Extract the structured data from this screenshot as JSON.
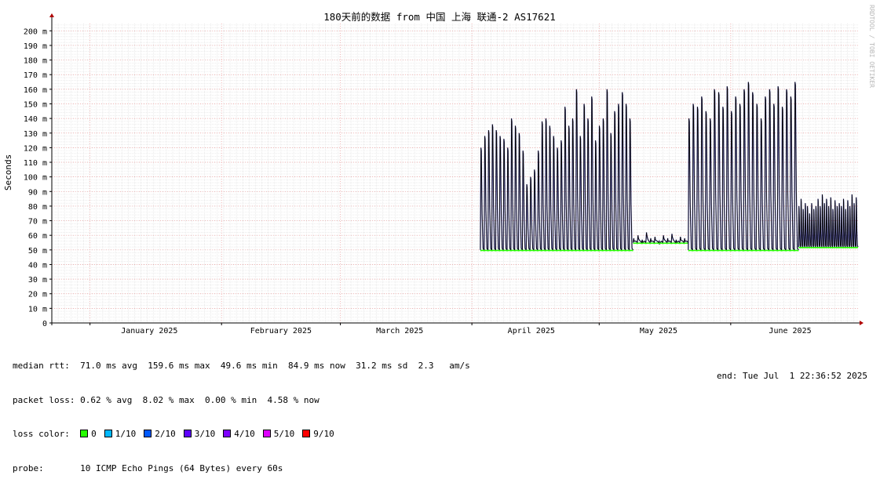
{
  "watermark": "RRDTOOL / TOBI OETIKER",
  "colors": {
    "grid_minor": "#e0e0e0",
    "grid_major": "#f0a0a0",
    "axis": "#000000",
    "arrow": "#b00000",
    "rtt_line": "#000000",
    "rtt_smoke": "#2020d0",
    "loss_0": "#26ff00",
    "loss_1": "#00b8ff",
    "loss_2": "#0059ff",
    "loss_3": "#5e00ff",
    "loss_4": "#7e00ff",
    "loss_5": "#dd00ff",
    "loss_9": "#ff0000"
  },
  "chart_data": {
    "type": "line",
    "title": "180天前的数据 from 中国 上海 联通-2 AS17621",
    "ylabel": "Seconds",
    "ylim": [
      0,
      205
    ],
    "y_tick_labels": [
      "0",
      "10 m",
      "20 m",
      "30 m",
      "40 m",
      "50 m",
      "60 m",
      "70 m",
      "80 m",
      "90 m",
      "100 m",
      "110 m",
      "120 m",
      "130 m",
      "140 m",
      "150 m",
      "160 m",
      "170 m",
      "180 m",
      "190 m",
      "200 m"
    ],
    "x_tick_labels": [
      "January 2025",
      "February 2025",
      "March 2025",
      "April 2025",
      "May 2025",
      "June 2025"
    ],
    "x_range": [
      "2024-12-23",
      "2025-07-01"
    ],
    "x_label_dates": [
      "2025-01-15",
      "2025-02-15",
      "2025-03-15",
      "2025-04-15",
      "2025-05-15",
      "2025-06-15"
    ],
    "x_major_dates": [
      "2025-01-01",
      "2025-02-01",
      "2025-03-01",
      "2025-04-01",
      "2025-05-01",
      "2025-06-01"
    ],
    "grid": true,
    "series": [
      {
        "name": "median rtt",
        "unit": "ms",
        "segments": [
          {
            "start": "2025-04-03",
            "end": "2025-05-09",
            "base": 50,
            "peaks": [
              120,
              128,
              132,
              136,
              132,
              128,
              126,
              120,
              140,
              135,
              130,
              118,
              95,
              100,
              105,
              118,
              138,
              140,
              135,
              128,
              120,
              125,
              148,
              135,
              140,
              160,
              128,
              150,
              140,
              155,
              125,
              135,
              140,
              160,
              130,
              145,
              150,
              158,
              150,
              140
            ]
          },
          {
            "start": "2025-05-09",
            "end": "2025-05-22",
            "base": 55,
            "peaks": [
              58,
              60,
              57,
              62,
              58,
              59,
              56,
              60,
              58,
              61,
              57,
              59,
              58
            ]
          },
          {
            "start": "2025-05-22",
            "end": "2025-06-17",
            "base": 50,
            "peaks": [
              140,
              150,
              148,
              155,
              145,
              140,
              160,
              158,
              148,
              162,
              145,
              155,
              150,
              160,
              165,
              158,
              150,
              140,
              155,
              160,
              150,
              162,
              148,
              160,
              155,
              165
            ]
          },
          {
            "start": "2025-06-17",
            "end": "2025-07-01",
            "base": 52,
            "peaks": [
              80,
              85,
              78,
              82,
              80,
              75,
              82,
              78,
              80,
              85,
              80,
              88,
              82,
              85,
              80,
              86,
              78,
              84,
              80,
              82,
              80,
              85,
              78,
              84,
              80,
              88,
              82,
              86
            ]
          }
        ]
      }
    ]
  },
  "stats": {
    "median_rtt_label": "median rtt:",
    "median_rtt_values": "71.0 ms avg  159.6 ms max  49.6 ms min  84.9 ms now  31.2 ms sd  2.3   am/s",
    "packet_loss_label": "packet loss:",
    "packet_loss_values": "0.62 % avg  8.02 % max  0.00 % min  4.58 % now",
    "loss_color_label": "loss color:",
    "loss_legend": [
      {
        "label": "0",
        "color": "#26ff00"
      },
      {
        "label": "1/10",
        "color": "#00b8ff"
      },
      {
        "label": "2/10",
        "color": "#0059ff"
      },
      {
        "label": "3/10",
        "color": "#5e00ff"
      },
      {
        "label": "4/10",
        "color": "#7e00ff"
      },
      {
        "label": "5/10",
        "color": "#dd00ff"
      },
      {
        "label": "9/10",
        "color": "#ff0000"
      }
    ],
    "probe_label": "probe:",
    "probe_value": "10 ICMP Echo Pings (64 Bytes) every 60s",
    "end_text": "end: Tue Jul  1 22:36:52 2025"
  }
}
